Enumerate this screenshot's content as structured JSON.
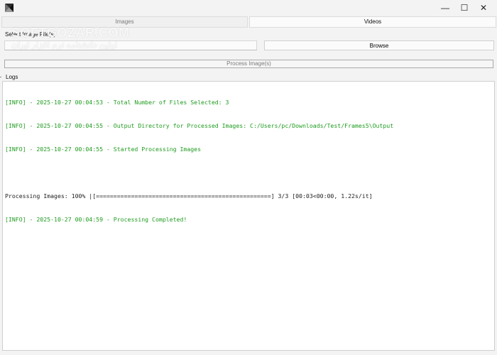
{
  "window": {
    "minimize_glyph": "—",
    "maximize_glyph": "☐",
    "close_glyph": "✕"
  },
  "tabs": [
    {
      "label": "Images",
      "active": false
    },
    {
      "label": "Videos",
      "active": true
    }
  ],
  "images_panel": {
    "select_label": "Select Image File(s)",
    "path_value": "",
    "browse_label": "Browse",
    "process_label": "Process Image(s)"
  },
  "logs": {
    "label": "Logs",
    "lines": [
      {
        "kind": "info",
        "text": "[INFO] - 2025-10-27 00:04:53 - Total Number of Files Selected: 3"
      },
      {
        "kind": "info",
        "text": "[INFO] - 2025-10-27 00:04:55 - Output Directory for Processed Images: C:/Users/pc/Downloads/Test/Frames5\\Output"
      },
      {
        "kind": "info",
        "text": "[INFO] - 2025-10-27 00:04:55 - Started Processing Images"
      },
      {
        "kind": "plain",
        "text": ""
      },
      {
        "kind": "plain",
        "text": "Processing Images: 100% |[==================================================] 3/3 [00:03<00:00, 1.22s/it]"
      },
      {
        "kind": "info",
        "text": "[INFO] - 2025-10-27 00:04:59 - Processing Completed!"
      }
    ]
  },
  "watermark": {
    "main": "SOFTGOZAR.COM",
    "sub": "اولین دانشنامه نرم افزار ایران"
  },
  "colors": {
    "info_text": "#1f9b1f",
    "background": "#f3f3f3"
  }
}
